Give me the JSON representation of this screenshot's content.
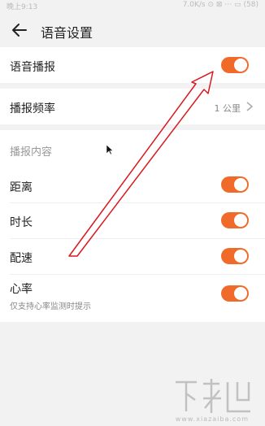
{
  "status_bar": {
    "left": "晚上9:13",
    "right": "7.0K/s ⊙ ⊠ ⋯ ▭ (58)"
  },
  "header": {
    "title": "语音设置",
    "back_icon": "back-arrow-icon"
  },
  "voice_broadcast": {
    "label": "语音播报",
    "enabled": true
  },
  "frequency": {
    "label": "播报频率",
    "value": "1 公里"
  },
  "content_section": {
    "title": "播报内容",
    "items": [
      {
        "label": "距离",
        "enabled": true
      },
      {
        "label": "时长",
        "enabled": true
      },
      {
        "label": "配速",
        "enabled": true
      },
      {
        "label": "心率",
        "subtitle": "仅支持心率监测时提示",
        "enabled": true
      }
    ]
  },
  "watermark": {
    "text": "下载吧",
    "sub": "www.xiazaiba.com"
  },
  "colors": {
    "accent": "#f06b2a",
    "annotation": "#d8191f"
  }
}
